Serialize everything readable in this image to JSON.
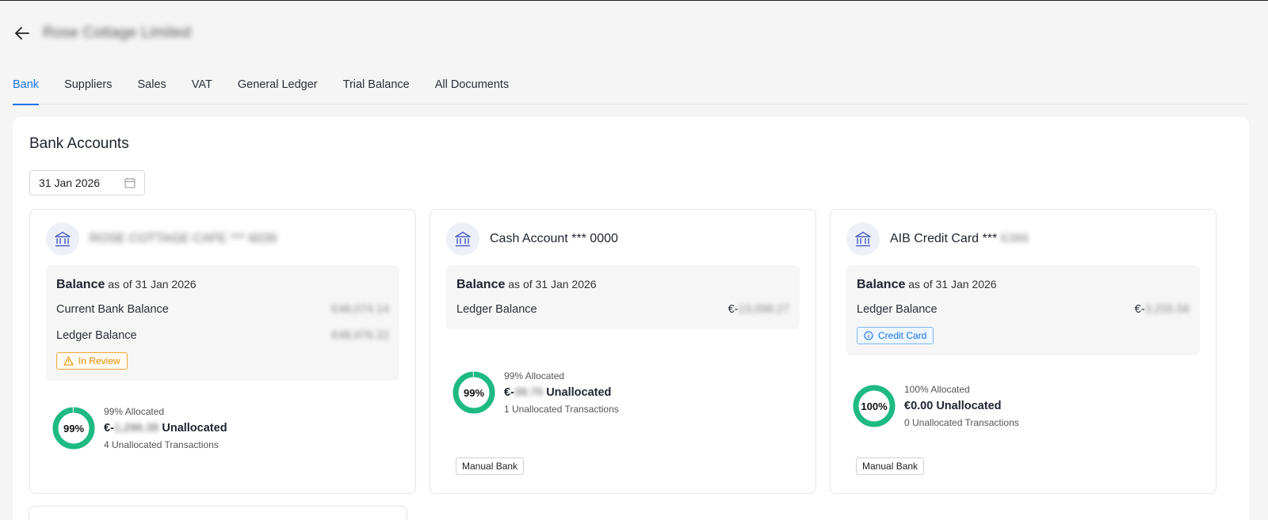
{
  "header": {
    "company_name": "Rose Cottage Limited"
  },
  "tabs": [
    {
      "label": "Bank",
      "active": true
    },
    {
      "label": "Suppliers"
    },
    {
      "label": "Sales"
    },
    {
      "label": "VAT"
    },
    {
      "label": "General Ledger"
    },
    {
      "label": "Trial Balance"
    },
    {
      "label": "All Documents"
    }
  ],
  "panel": {
    "title": "Bank Accounts",
    "date": "31 Jan 2026"
  },
  "cards": [
    {
      "title": "ROSE COTTAGE CAFE *** 6039",
      "balance_label": "Balance",
      "balance_asof": "as of 31 Jan 2026",
      "rows": [
        {
          "label": "Current Bank Balance",
          "value": "€48,074.14"
        },
        {
          "label": "Ledger Balance",
          "value": "€48,976.22"
        }
      ],
      "status_tag": "In Review",
      "allocated_pct": "99%",
      "allocated_fraction": 0.99,
      "allocated_label": "99% Allocated",
      "unallocated_prefix": "€-",
      "unallocated_amount": "1,296.38",
      "unallocated_suffix": "Unallocated",
      "unallocated_txns": "4 Unallocated Transactions"
    },
    {
      "title": "Cash Account *** 0000",
      "balance_label": "Balance",
      "balance_asof": "as of 31 Jan 2026",
      "rows": [
        {
          "label": "Ledger Balance",
          "value_prefix": "€-",
          "value": "13,098.27"
        }
      ],
      "allocated_pct": "99%",
      "allocated_fraction": 0.99,
      "allocated_label": "99% Allocated",
      "unallocated_prefix": "€-",
      "unallocated_amount": "39.75",
      "unallocated_suffix": "Unallocated",
      "unallocated_txns": "1 Unallocated Transactions",
      "bank_type": "Manual Bank"
    },
    {
      "title_main": "AIB Credit Card ***",
      "title_suffix": "6386",
      "balance_label": "Balance",
      "balance_asof": "as of 31 Jan 2026",
      "rows": [
        {
          "label": "Ledger Balance",
          "value_prefix": "€-",
          "value": "3,255.56"
        }
      ],
      "info_tag": "Credit Card",
      "allocated_pct": "100%",
      "allocated_fraction": 1.0,
      "allocated_label": "100% Allocated",
      "unallocated_full": "€0.00 Unallocated",
      "unallocated_txns": "0 Unallocated Transactions",
      "bank_type": "Manual Bank"
    }
  ],
  "colors": {
    "accent": "#1a73e8",
    "ring_green": "#1dba82",
    "review_orange": "#e08b00"
  }
}
